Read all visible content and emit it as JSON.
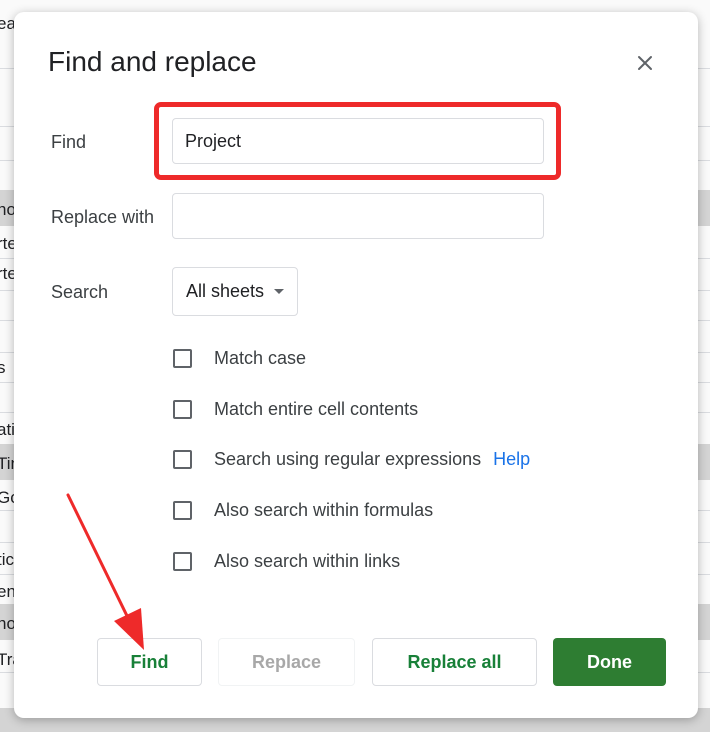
{
  "background_sheet": {
    "fragments": [
      "eat",
      "no",
      "rte",
      "rte",
      "s",
      "ati",
      "Tin",
      "Go",
      "tic",
      "en",
      "no",
      "Tra"
    ]
  },
  "dialog": {
    "title": "Find and replace",
    "close_icon": "close-icon",
    "find": {
      "label": "Find",
      "value": "Project",
      "placeholder": ""
    },
    "replace": {
      "label": "Replace with",
      "value": "",
      "placeholder": ""
    },
    "search": {
      "label": "Search",
      "selected": "All sheets"
    },
    "options": [
      {
        "label": "Match case",
        "checked": false
      },
      {
        "label": "Match entire cell contents",
        "checked": false
      },
      {
        "label": "Search using regular expressions",
        "checked": false
      },
      {
        "label": "Also search within formulas",
        "checked": false
      },
      {
        "label": "Also search within links",
        "checked": false
      }
    ],
    "help_label": "Help",
    "buttons": {
      "find": "Find",
      "replace": "Replace",
      "replace_all": "Replace all",
      "done": "Done"
    }
  },
  "colors": {
    "annotation_red": "#ee2a2a",
    "primary_green": "#2e7d32",
    "link_blue": "#1a73e8"
  }
}
